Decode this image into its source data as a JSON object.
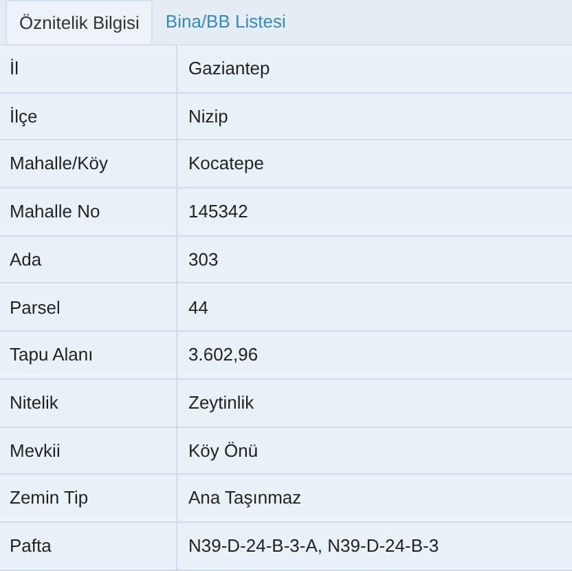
{
  "tabs": [
    {
      "label": "Öznitelik Bilgisi",
      "selected": true
    },
    {
      "label": "Bina/BB Listesi",
      "selected": false
    }
  ],
  "rows": [
    {
      "label": "İl",
      "value": "Gaziantep"
    },
    {
      "label": "İlçe",
      "value": "Nizip"
    },
    {
      "label": "Mahalle/Köy",
      "value": "Kocatepe"
    },
    {
      "label": "Mahalle No",
      "value": "145342"
    },
    {
      "label": "Ada",
      "value": "303"
    },
    {
      "label": "Parsel",
      "value": "44"
    },
    {
      "label": "Tapu Alanı",
      "value": "3.602,96"
    },
    {
      "label": "Nitelik",
      "value": "Zeytinlik"
    },
    {
      "label": "Mevkii",
      "value": "Köy Önü"
    },
    {
      "label": "Zemin Tip",
      "value": "Ana Taşınmaz"
    },
    {
      "label": "Pafta",
      "value": "N39-D-24-B-3-A, N39-D-24-B-3"
    }
  ]
}
